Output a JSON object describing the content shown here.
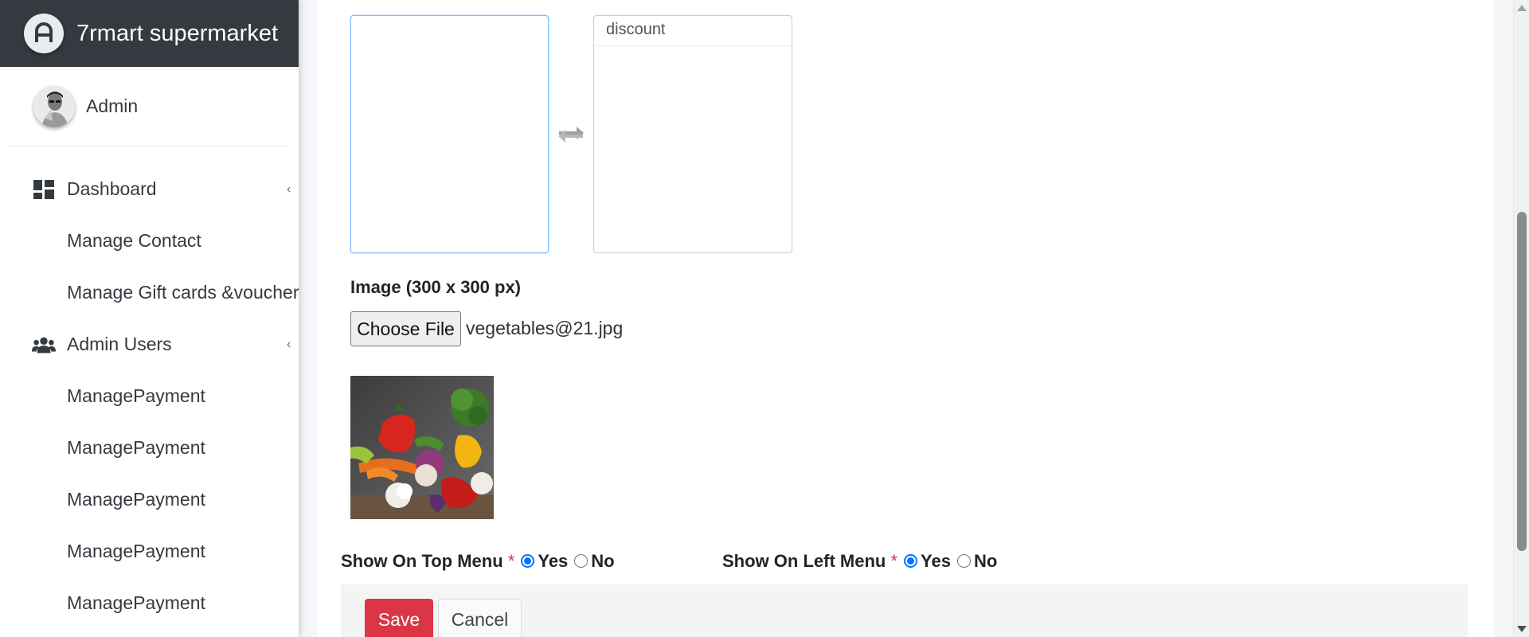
{
  "brand": {
    "name": "7rmart supermarket"
  },
  "user": {
    "name": "Admin"
  },
  "sidebar": {
    "items": [
      {
        "label": "Dashboard",
        "icon": "dashboard-icon",
        "has_caret": true
      },
      {
        "label": "Manage Contact"
      },
      {
        "label": "Manage Gift cards &voucher"
      },
      {
        "label": "Admin Users",
        "icon": "users-icon",
        "has_caret": true
      },
      {
        "label": "ManagePayment"
      },
      {
        "label": "ManagePayment"
      },
      {
        "label": "ManagePayment"
      },
      {
        "label": "ManagePayment"
      },
      {
        "label": "ManagePayment"
      }
    ]
  },
  "form": {
    "selected_list": [],
    "available_list": [
      "discount"
    ],
    "image_label": "Image (300 x 300 px)",
    "choose_file_label": "Choose File",
    "file_name": "vegetables@21.jpg",
    "top_menu": {
      "label": "Show On Top Menu",
      "required": "*",
      "yes": "Yes",
      "no": "No",
      "value": "Yes"
    },
    "left_menu": {
      "label": "Show On Left Menu",
      "required": "*",
      "yes": "Yes",
      "no": "No",
      "value": "Yes"
    },
    "save_label": "Save",
    "cancel_label": "Cancel"
  },
  "colors": {
    "brand_bg": "#343a40",
    "danger": "#dc3545",
    "focus": "#80bdff",
    "radio": "#0075ff"
  }
}
